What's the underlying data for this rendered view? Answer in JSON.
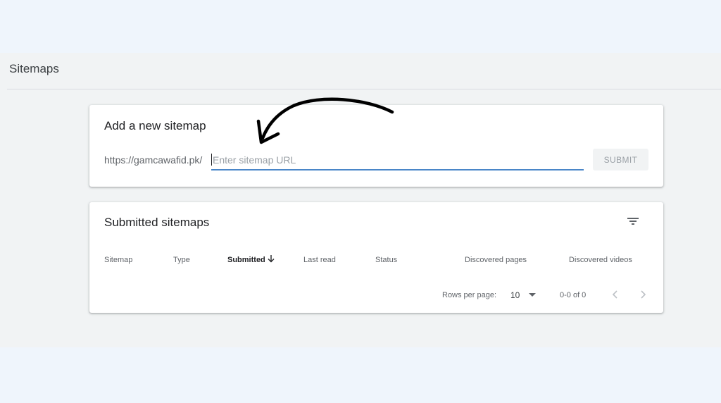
{
  "page": {
    "title": "Sitemaps"
  },
  "add_sitemap": {
    "title": "Add a new sitemap",
    "url_prefix": "https://gamcawafid.pk/",
    "input_placeholder": "Enter sitemap URL",
    "input_value": "",
    "submit_label": "SUBMIT"
  },
  "submitted": {
    "title": "Submitted sitemaps",
    "filter_icon": "filter-list-icon",
    "columns": [
      "Sitemap",
      "Type",
      "Submitted",
      "Last read",
      "Status",
      "Discovered pages",
      "Discovered videos"
    ],
    "sorted_column": "Submitted",
    "sort_icon": "arrow-down-icon",
    "rows_per_page_label": "Rows per page:",
    "rows_per_page_value": "10",
    "range_text": "0-0 of 0"
  },
  "colors": {
    "accent": "#4a86c8",
    "background": "#eff5fc",
    "panel": "#f1f3f4"
  }
}
